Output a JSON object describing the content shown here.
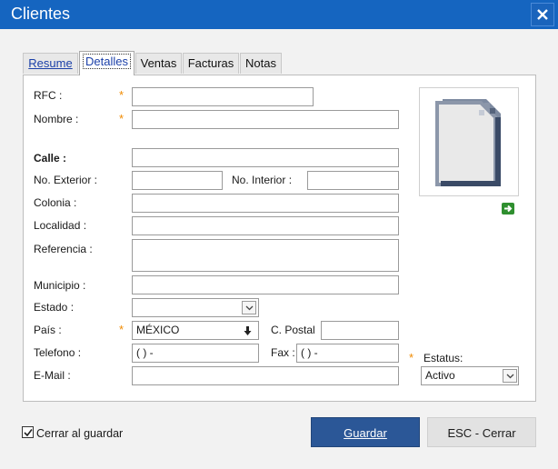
{
  "window": {
    "title": "Clientes"
  },
  "tabs": [
    {
      "label": "Resume",
      "active": false
    },
    {
      "label": "Detalles",
      "active": true
    },
    {
      "label": "Ventas",
      "active": false
    },
    {
      "label": "Facturas",
      "active": false
    },
    {
      "label": "Notas",
      "active": false
    }
  ],
  "form": {
    "rfc": {
      "label": "RFC :",
      "value": ""
    },
    "nombre": {
      "label": "Nombre :",
      "value": ""
    },
    "calle": {
      "label": "Calle :",
      "value": ""
    },
    "no_exterior": {
      "label": "No. Exterior :",
      "value": ""
    },
    "no_interior": {
      "label": "No. Interior :",
      "value": ""
    },
    "colonia": {
      "label": "Colonia :",
      "value": ""
    },
    "localidad": {
      "label": "Localidad :",
      "value": ""
    },
    "referencia": {
      "label": "Referencia :",
      "value": ""
    },
    "municipio": {
      "label": "Municipio :",
      "value": ""
    },
    "estado": {
      "label": "Estado :",
      "value": ""
    },
    "pais": {
      "label": "País :",
      "value": "MÉXICO"
    },
    "c_postal": {
      "label": "C. Postal",
      "value": ""
    },
    "telefono": {
      "label": "Telefono :",
      "value": "(   )   -"
    },
    "fax": {
      "label": "Fax :",
      "value": "(   )   -"
    },
    "email": {
      "label": "E-Mail :",
      "value": ""
    },
    "estatus": {
      "label": "Estatus:",
      "value": "Activo"
    }
  },
  "required_mark": "*",
  "footer": {
    "cerrar_label": "Cerrar al guardar",
    "cerrar_checked": true,
    "guardar_label": "Guardar",
    "cerrar_button_label": "ESC - Cerrar"
  },
  "colors": {
    "titlebar": "#1565c0",
    "primary_button": "#2b5797",
    "required": "#f08a00",
    "link_tab": "#1a3fa8"
  },
  "icons": [
    "close-icon",
    "document-placeholder-icon",
    "green-arrow-icon",
    "chevron-down-icon",
    "arrow-down-icon",
    "checkmark-icon"
  ]
}
